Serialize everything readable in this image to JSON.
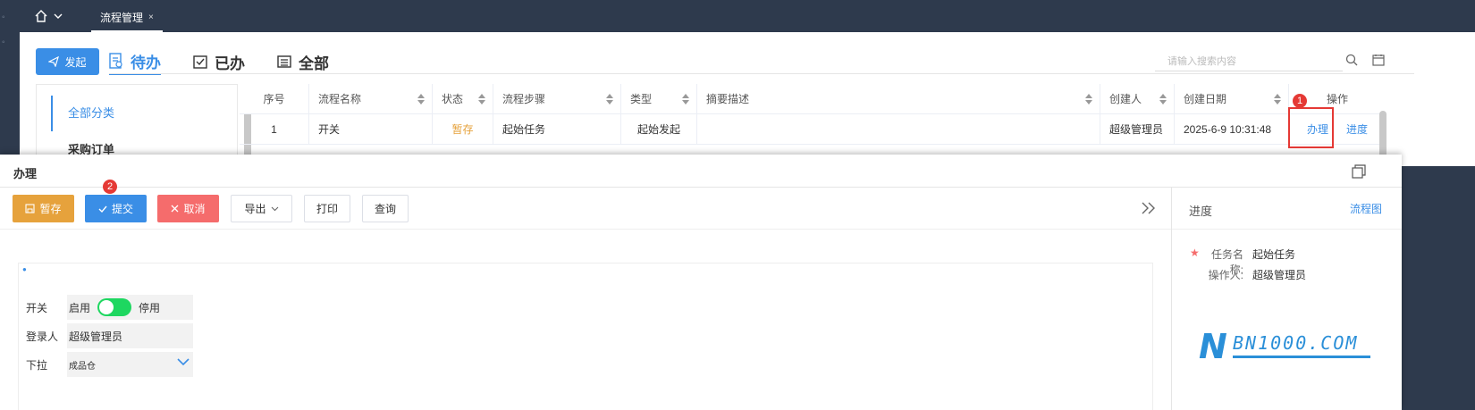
{
  "topbar": {
    "tab_label": "流程管理",
    "tab_close": "×"
  },
  "main": {
    "launch_label": "发起",
    "view_tabs": [
      {
        "label": "待办",
        "icon": "todo-doc-icon"
      },
      {
        "label": "已办",
        "icon": "checked-box-icon"
      },
      {
        "label": "全部",
        "icon": "list-icon"
      }
    ],
    "search_placeholder": "请输入搜索内容"
  },
  "categories": {
    "active": "全部分类",
    "items": [
      "采购订单"
    ]
  },
  "table": {
    "columns": [
      "序号",
      "流程名称",
      "状态",
      "流程步骤",
      "类型",
      "摘要描述",
      "创建人",
      "创建日期",
      "操作"
    ],
    "rows": [
      {
        "index": "1",
        "name": "开关",
        "status": "暂存",
        "step": "起始任务",
        "type": "起始发起",
        "summary": "",
        "creator": "超级管理员",
        "date": "2025-6-9 10:31:48",
        "action_handle": "办理",
        "action_progress": "进度"
      }
    ]
  },
  "annotations": {
    "badge_1": "1",
    "badge_2": "2",
    "highlight_color": "#e53935"
  },
  "modal": {
    "title": "办理",
    "toolbar": {
      "save": "暂存",
      "submit": "提交",
      "cancel": "取消",
      "export": "导出",
      "print": "打印",
      "query": "查询"
    },
    "form": {
      "switch_label": "开关",
      "switch_on": "启用",
      "switch_off": "停用",
      "login_label": "登录人",
      "login_value": "超级管理员",
      "dropdown_label": "下拉",
      "dropdown_value": "成品仓"
    },
    "progress": {
      "title": "进度",
      "chart_link": "流程图",
      "task_key": "任务名称:",
      "task_value": "起始任务",
      "operator_key": "操作人:",
      "operator_value": "超级管理员"
    },
    "logo": {
      "mark": "N",
      "text": "BN1000.COM"
    }
  },
  "colors": {
    "primary": "#3a8ee6",
    "warning": "#e6a23c",
    "danger": "#f56c6c",
    "sidebar_bg": "#2e3a4d",
    "toggle_on": "#1ed760"
  }
}
